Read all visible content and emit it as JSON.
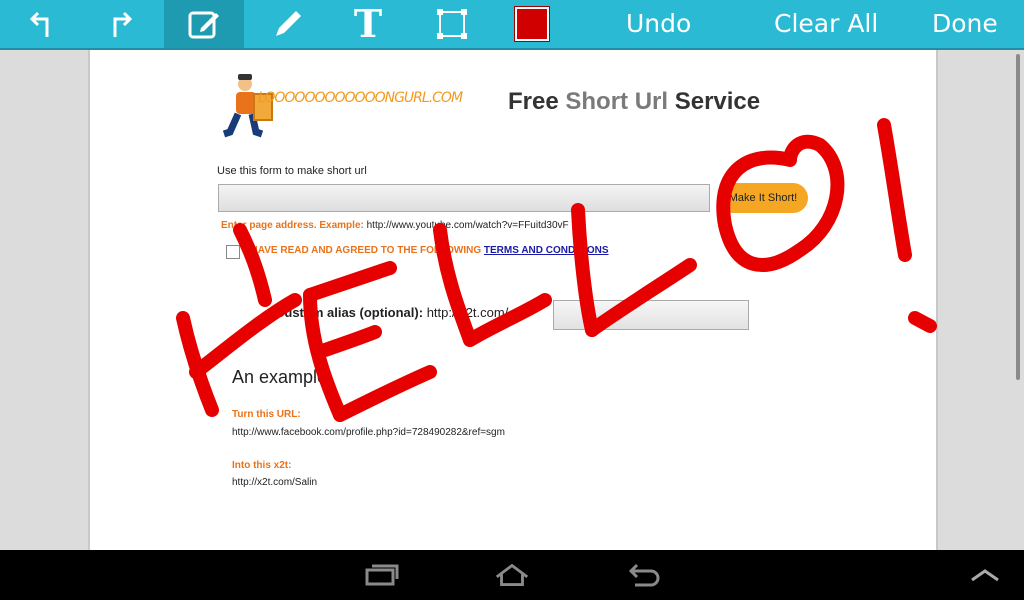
{
  "toolbar": {
    "undo_label": "Undo",
    "clear_all_label": "Clear All",
    "done_label": "Done",
    "icons": [
      "turn-left-icon",
      "turn-right-icon",
      "edit-square-icon",
      "pencil-icon",
      "text-icon",
      "crop-frame-icon",
      "color-swatch"
    ],
    "pen_color": "#d10000",
    "accent": "#2bbad3"
  },
  "page": {
    "logo_text": "LOOOOOOOOOOOONGURL.COM",
    "title_prefix": "Free",
    "title_accent": "Short Url",
    "title_suffix": "Service",
    "form_label": "Use this form to make short url",
    "url_input_value": "",
    "make_button_label": "Make It Short!",
    "hint_label": "Enter page address. Example:",
    "hint_example": "http://www.youtube.com/watch?v=FFuitd30vF",
    "agree_text": "I HAVE READ AND AGREED TO THE FOLLOWING",
    "agree_link": "TERMS AND CONDITIONS",
    "alias_label": "Custom alias (optional):",
    "alias_prefix": "http://x2t.com/",
    "alias_input_value": "",
    "example_title": "An example",
    "turn_label": "Turn this URL:",
    "turn_value": "http://www.facebook.com/profile.php?id=728490282&ref=sgm",
    "into_label": "Into this x2t:",
    "into_value": "http://x2t.com/Salin"
  },
  "annotation": {
    "handwritten_text": "HELLO!",
    "color": "#e60000"
  },
  "navbar": {
    "icons": [
      "recent-apps-icon",
      "home-icon",
      "back-icon",
      "menu-up-icon"
    ]
  }
}
